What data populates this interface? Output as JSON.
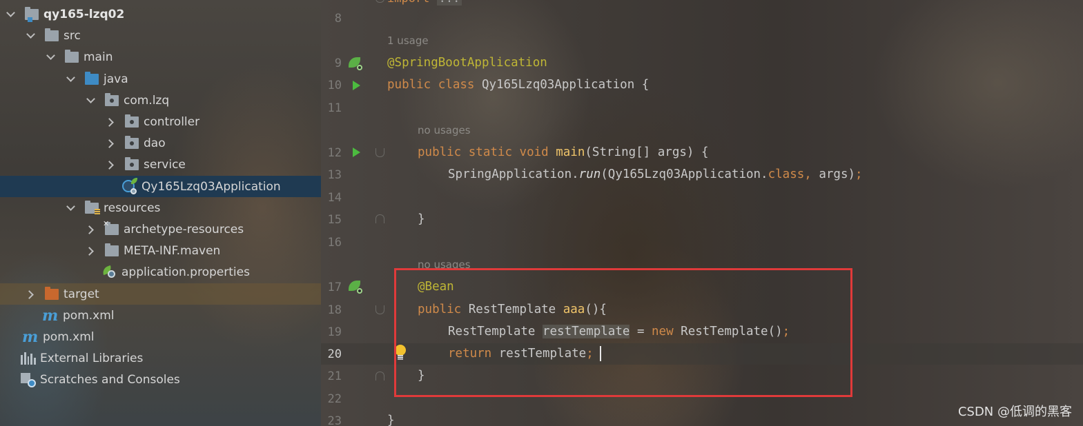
{
  "project_tree": {
    "rows": [
      {
        "label": "qy165-lzq02",
        "icon": "module-folder-icon",
        "indent": 0,
        "chevron": "down",
        "bold": true
      },
      {
        "label": "src",
        "icon": "folder-icon",
        "indent": 1,
        "chevron": "down"
      },
      {
        "label": "main",
        "icon": "folder-icon",
        "indent": 2,
        "chevron": "down"
      },
      {
        "label": "java",
        "icon": "source-folder-icon",
        "indent": 3,
        "chevron": "down"
      },
      {
        "label": "com.lzq",
        "icon": "package-icon",
        "indent": 4,
        "chevron": "down"
      },
      {
        "label": "controller",
        "icon": "package-icon",
        "indent": 5,
        "chevron": "right"
      },
      {
        "label": "dao",
        "icon": "package-icon",
        "indent": 5,
        "chevron": "right"
      },
      {
        "label": "service",
        "icon": "package-icon",
        "indent": 5,
        "chevron": "right"
      },
      {
        "label": "Qy165Lzq03Application",
        "icon": "spring-boot-app-icon",
        "indent": 5,
        "chevron": "none",
        "selected": true
      },
      {
        "label": "resources",
        "icon": "resources-folder-icon",
        "indent": 3,
        "chevron": "down"
      },
      {
        "label": "archetype-resources",
        "icon": "excluded-folder-icon",
        "indent": 4,
        "chevron": "right"
      },
      {
        "label": "META-INF.maven",
        "icon": "folder-icon",
        "indent": 4,
        "chevron": "right"
      },
      {
        "label": "application.properties",
        "icon": "spring-properties-icon",
        "indent": 4,
        "chevron": "none"
      },
      {
        "label": "target",
        "icon": "excluded-output-folder-icon",
        "indent": 1,
        "chevron": "right",
        "highlight": true
      },
      {
        "label": "pom.xml",
        "icon": "maven-icon",
        "indent": 1,
        "chevron": "none"
      },
      {
        "label": "pom.xml",
        "icon": "maven-icon",
        "indent": 0,
        "chevron": "none"
      },
      {
        "label": "External Libraries",
        "icon": "libraries-icon",
        "indent": 0,
        "chevron": "none"
      },
      {
        "label": "Scratches and Consoles",
        "icon": "scratches-icon",
        "indent": 0,
        "chevron": "none"
      }
    ]
  },
  "editor": {
    "imports_text": "import ",
    "imports_fold": "...",
    "hints": {
      "usage_class": "1 usage",
      "usage_main": "no usages",
      "usage_bean": "no usages"
    },
    "line_numbers": [
      "8",
      "9",
      "10",
      "11",
      "12",
      "13",
      "14",
      "15",
      "16",
      "17",
      "18",
      "19",
      "20",
      "21",
      "22",
      "23"
    ],
    "active_line": "20",
    "code": {
      "l9_annotation": "@SpringBootApplication",
      "l10_kw1": "public",
      "l10_kw2": "class",
      "l10_rest": " Qy165Lzq03Application {",
      "l12_kw1": "public",
      "l12_kw2": "static",
      "l12_kw3": "void",
      "l12_fn": "main",
      "l12_rest": "(String[] args) {",
      "l13_a": "SpringApplication.",
      "l13_run": "run",
      "l13_b": "(Qy165Lzq03Application.",
      "l13_cls": "class",
      "l13_comma": ",",
      "l13_c": " args)",
      "l13_semi": ";",
      "l15": "}",
      "l17_annotation": "@Bean",
      "l18_kw": "public",
      "l18_type": " RestTemplate ",
      "l18_fn": "aaa",
      "l18_rest": "(){",
      "l19_type": "RestTemplate ",
      "l19_var": "restTemplate",
      "l19_eq": " = ",
      "l19_new": "new",
      "l19_rest": " RestTemplate()",
      "l19_semi": ";",
      "l20_kw": "return",
      "l20_rest": " restTemplate",
      "l20_semi": ";",
      "l21": "}",
      "l23": "}"
    }
  },
  "watermark": "CSDN @低调的黑客",
  "colors": {
    "highlight_box": "#e03a3a",
    "selection": "#1f3a52",
    "keyword": "#d08a4a",
    "annotation": "#bfb635"
  }
}
